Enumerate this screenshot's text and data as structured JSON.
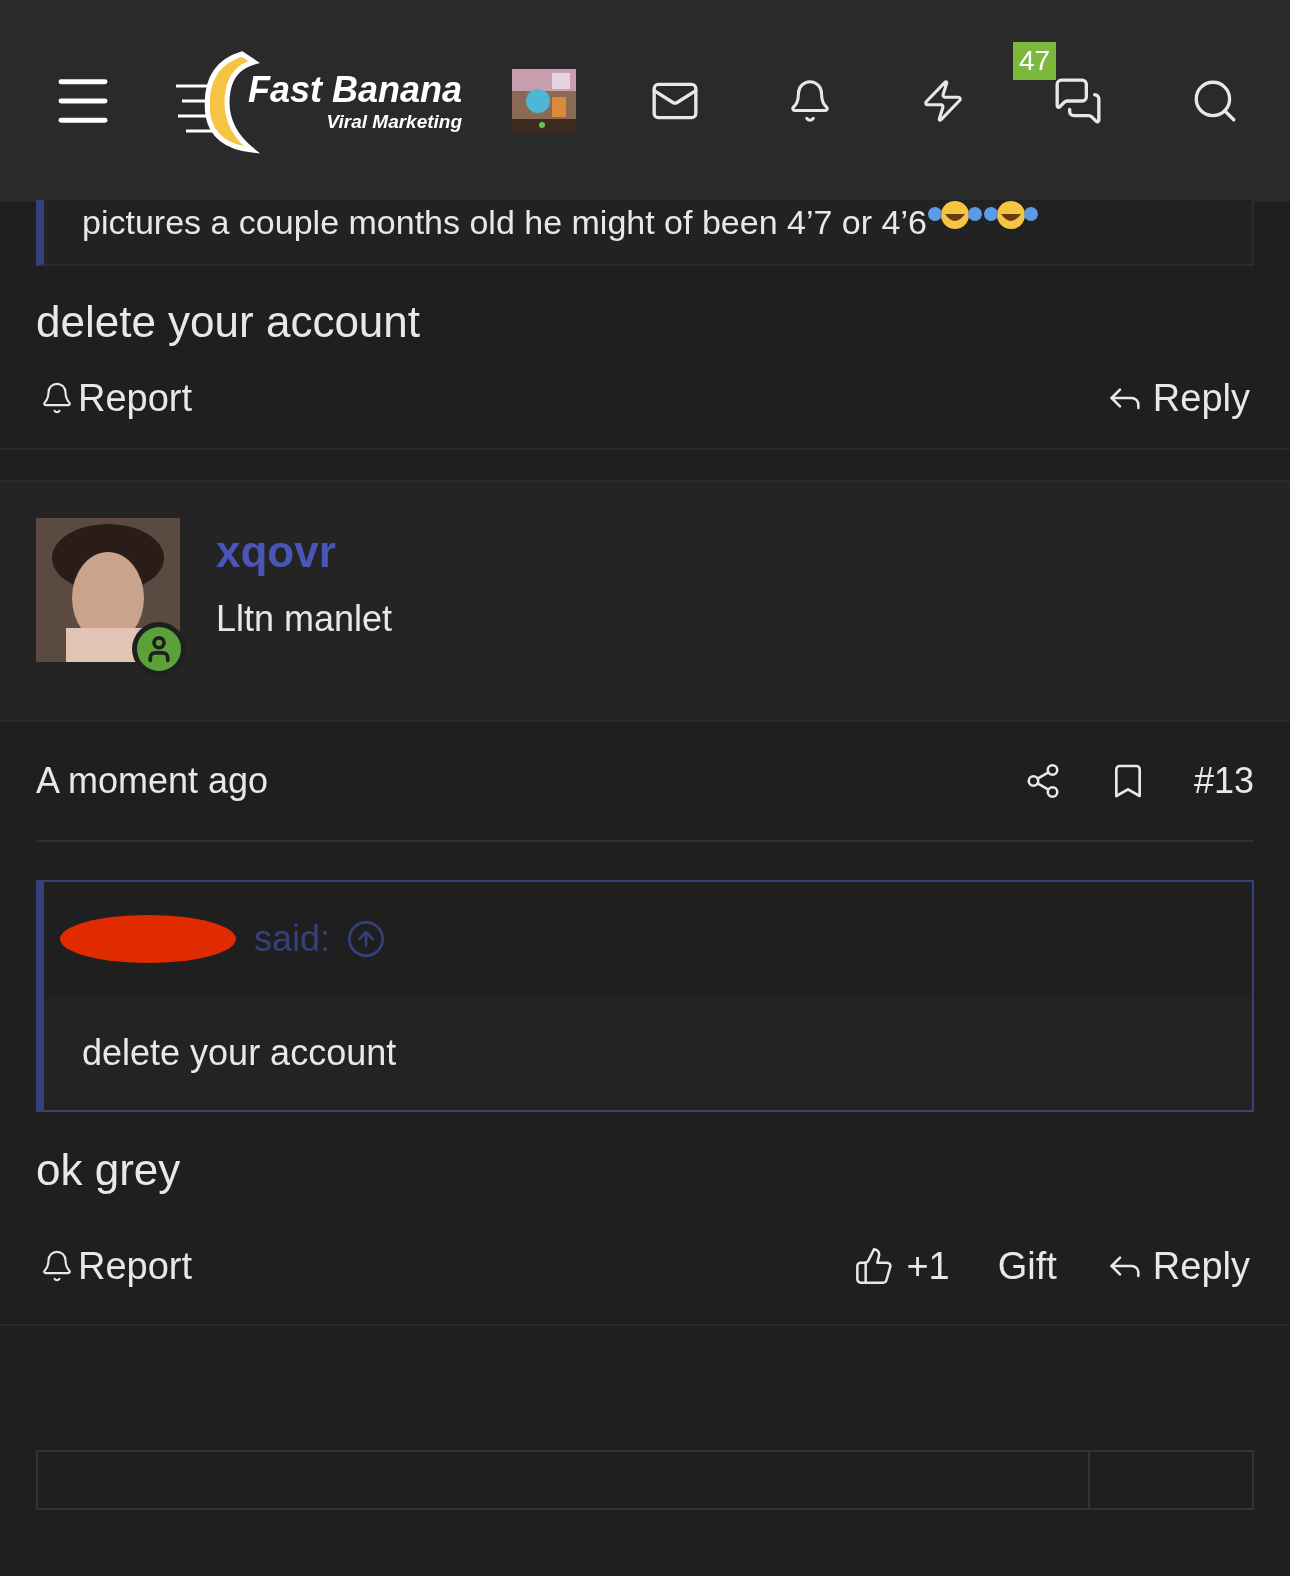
{
  "header": {
    "logo_title": "Fast Banana",
    "logo_subtitle": "Viral Marketing",
    "conversations_badge": "47"
  },
  "previous_post": {
    "quote_tail": "pictures a couple months old he might of been 4’7 or 4’6",
    "message": "delete your account",
    "report": "Report",
    "reply": "Reply"
  },
  "post": {
    "username": "xqovr",
    "user_title": "Lltn manlet",
    "online": true,
    "time": "A moment ago",
    "number": "#13",
    "quote": {
      "attribution": "said:",
      "text": "delete your account"
    },
    "message": "ok grey",
    "report": "Report",
    "like": "+1",
    "gift": "Gift",
    "reply": "Reply"
  }
}
